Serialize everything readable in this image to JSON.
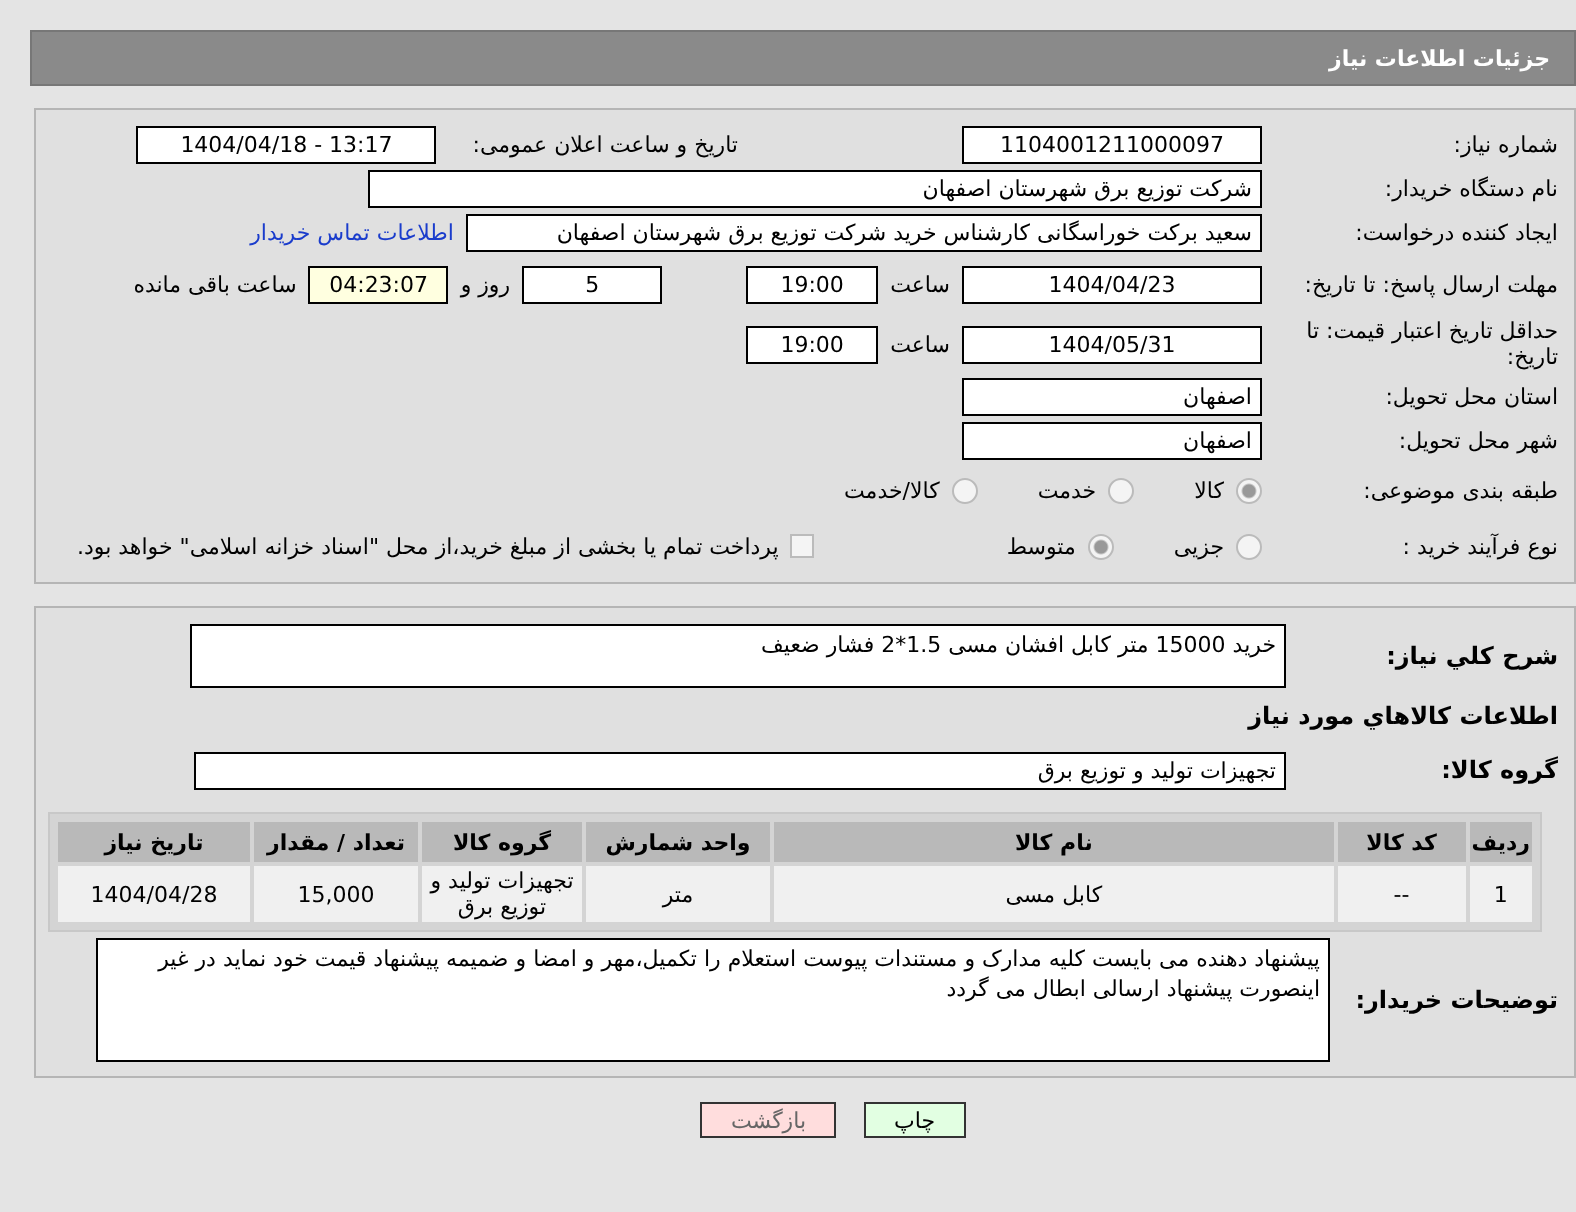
{
  "title": "جزئیات اطلاعات نیاز",
  "need_number": {
    "label": "شماره نیاز:",
    "value": "1104001211000097"
  },
  "announce": {
    "label": "تاریخ و ساعت اعلان عمومی:",
    "value": "1404/04/18 - 13:17"
  },
  "buyer_org": {
    "label": "نام دستگاه خریدار:",
    "value": "شرکت توزیع برق شهرستان اصفهان"
  },
  "requester": {
    "label": "ایجاد کننده درخواست:",
    "value": "سعید برکت خوراسگانی کارشناس خرید شرکت توزیع برق شهرستان اصفهان",
    "link": "اطلاعات تماس خریدار"
  },
  "reply_deadline": {
    "label": "مهلت ارسال پاسخ: تا تاریخ:",
    "date": "1404/04/23",
    "time_label": "ساعت",
    "time": "19:00",
    "days": "5",
    "days_label": "روز و",
    "remaining": "04:23:07",
    "remaining_label": "ساعت باقی مانده"
  },
  "price_validity": {
    "label": "حداقل تاریخ اعتبار قیمت: تا تاریخ:",
    "date": "1404/05/31",
    "time_label": "ساعت",
    "time": "19:00"
  },
  "province": {
    "label": "استان محل تحویل:",
    "value": "اصفهان"
  },
  "city": {
    "label": "شهر محل تحویل:",
    "value": "اصفهان"
  },
  "category": {
    "label": "طبقه بندی موضوعی:",
    "options": [
      {
        "label": "کالا",
        "selected": true
      },
      {
        "label": "خدمت",
        "selected": false
      },
      {
        "label": "کالا/خدمت",
        "selected": false
      }
    ]
  },
  "process": {
    "label": "نوع فرآیند خرید :",
    "options": [
      {
        "label": "جزیی",
        "selected": false
      },
      {
        "label": "متوسط",
        "selected": true
      }
    ],
    "payment_note": {
      "label": "پرداخت تمام یا بخشی از مبلغ خرید،از محل \"اسناد خزانه اسلامی\" خواهد بود.",
      "checked": false
    }
  },
  "description": {
    "label": "شرح کلي نياز:",
    "value": "خرید 15000 متر کابل افشان مسی 1.5*2 فشار ضعیف"
  },
  "goods_heading": "اطلاعات کالاهاي مورد نياز",
  "goods_group": {
    "label": "گروه کالا:",
    "value": "تجهیزات تولید و توزیع برق"
  },
  "table": {
    "columns": [
      "ردیف",
      "کد کالا",
      "نام کالا",
      "واحد شمارش",
      "گروه کالا",
      "تعداد / مقدار",
      "تاریخ نیاز"
    ],
    "rows": [
      [
        "1",
        "--",
        "کابل مسی",
        "متر",
        "تجهیزات تولید و توزیع برق",
        "15,000",
        "1404/04/28"
      ]
    ]
  },
  "buyer_notes": {
    "label": "توضیحات خریدار:",
    "value": "پیشنهاد دهنده می بایست کلیه مدارک و مستندات پیوست استعلام را تکمیل،مهر و امضا و ضمیمه پیشنهاد قیمت خود نماید در غیر اینصورت پیشنهاد ارسالی ابطال می گردد"
  },
  "buttons": [
    {
      "label": "چاپ",
      "kind": "print"
    },
    {
      "label": "بازگشت",
      "kind": "back"
    }
  ]
}
